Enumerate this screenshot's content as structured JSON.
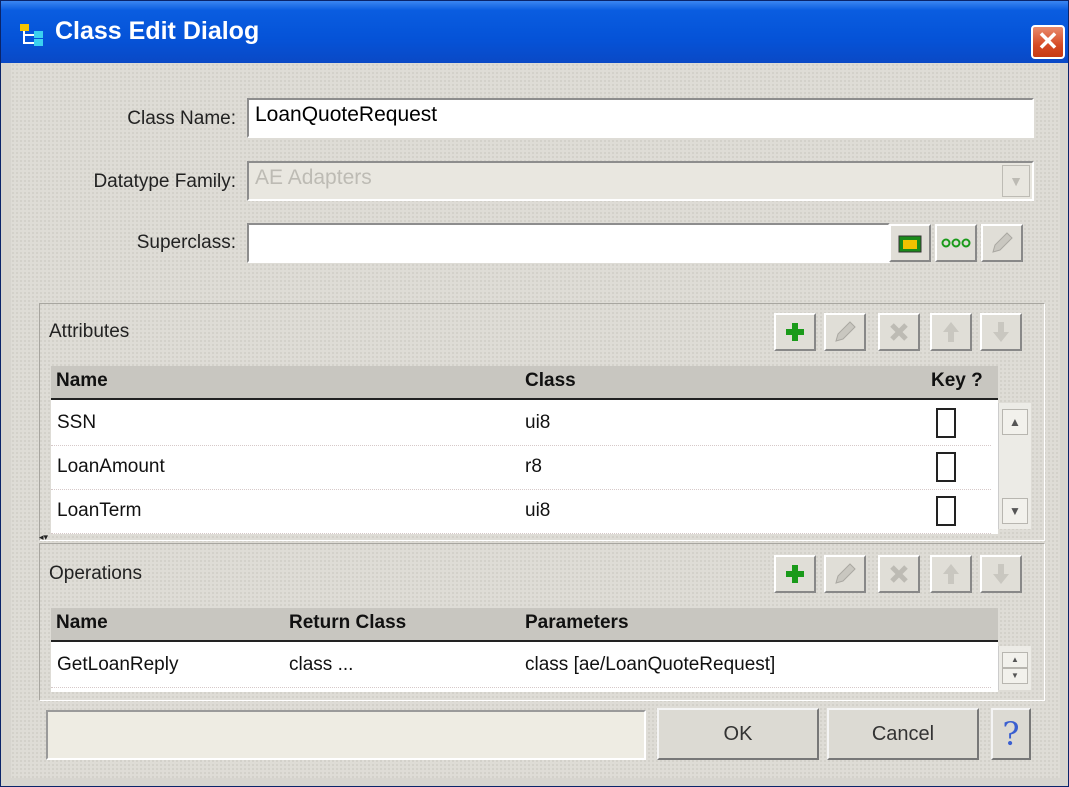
{
  "window": {
    "title": "Class Edit Dialog",
    "close_label": "✕"
  },
  "form": {
    "class_name_label": "Class Name:",
    "class_name_value": "LoanQuoteRequest",
    "datatype_family_label": "Datatype Family:",
    "datatype_family_value": "AE Adapters",
    "superclass_label": "Superclass:",
    "superclass_value": ""
  },
  "attributes": {
    "label": "Attributes",
    "columns": [
      "Name",
      "Class",
      "Key ?"
    ],
    "rows": [
      {
        "name": "SSN",
        "class": "ui8"
      },
      {
        "name": "LoanAmount",
        "class": "r8"
      },
      {
        "name": "LoanTerm",
        "class": "ui8"
      }
    ]
  },
  "operations": {
    "label": "Operations",
    "columns": [
      "Name",
      "Return Class",
      "Parameters"
    ],
    "rows": [
      {
        "name": "GetLoanReply",
        "return_class": "class ...",
        "parameters": "class [ae/LoanQuoteRequest]"
      }
    ]
  },
  "buttons": {
    "ok": "OK",
    "cancel": "Cancel",
    "help": "?"
  },
  "colors": {
    "title_bar": "#0553d8",
    "add_green": "#1a9a1a",
    "close_red": "#d64a25"
  }
}
